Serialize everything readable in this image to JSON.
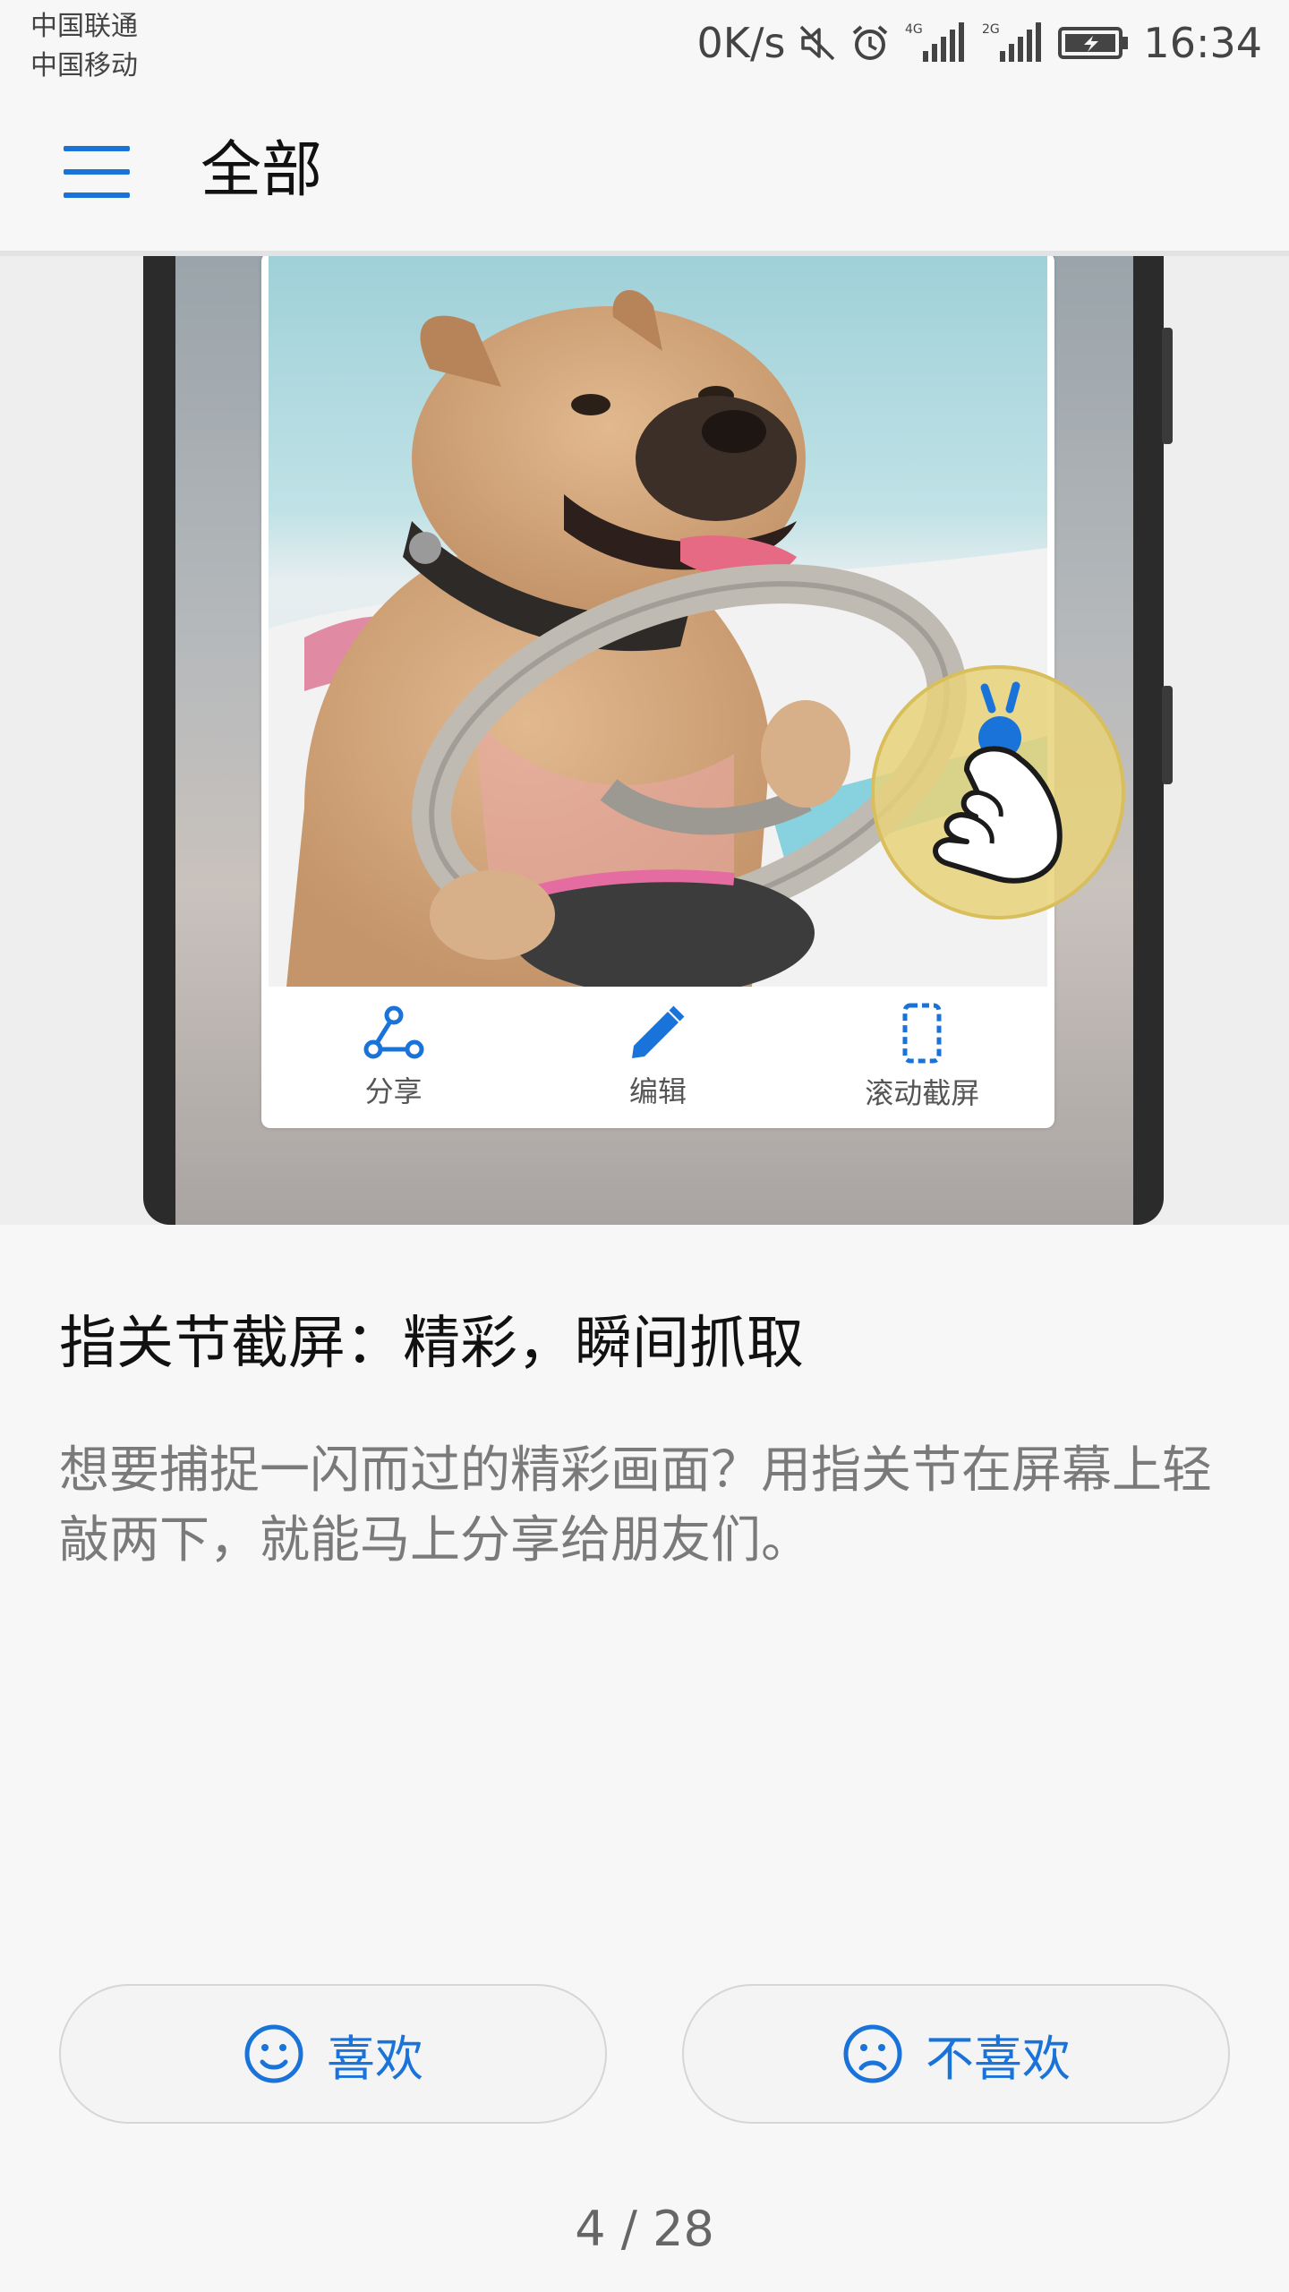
{
  "status_bar": {
    "carrier_1": "中国联通",
    "carrier_2": "中国移动",
    "net_speed": "0K/s",
    "signal_1_label": "4G",
    "signal_2_label": "2G",
    "time": "16:34",
    "icons": [
      "mute-icon",
      "alarm-icon",
      "signal-4g-icon",
      "signal-2g-icon",
      "battery-charging-icon"
    ]
  },
  "app_bar": {
    "title": "全部",
    "menu_icon": "hamburger-menu-icon"
  },
  "illustration": {
    "actions": [
      {
        "label": "分享",
        "icon": "share-icon"
      },
      {
        "label": "编辑",
        "icon": "edit-icon"
      },
      {
        "label": "滚动截屏",
        "icon": "scroll-screenshot-icon"
      }
    ],
    "badge_icon": "knuckle-tap-icon"
  },
  "content": {
    "title": "指关节截屏：精彩，瞬间抓取",
    "description": "想要捕捉一闪而过的精彩画面？用指关节在屏幕上轻敲两下，就能马上分享给朋友们。"
  },
  "feedback": {
    "like_label": "喜欢",
    "dislike_label": "不喜欢",
    "like_icon": "smile-icon",
    "dislike_icon": "frown-icon"
  },
  "pager": {
    "text": "4 / 28"
  },
  "colors": {
    "accent": "#1a73d9",
    "background": "#f7f7f7",
    "badge": "#e8d27a"
  }
}
